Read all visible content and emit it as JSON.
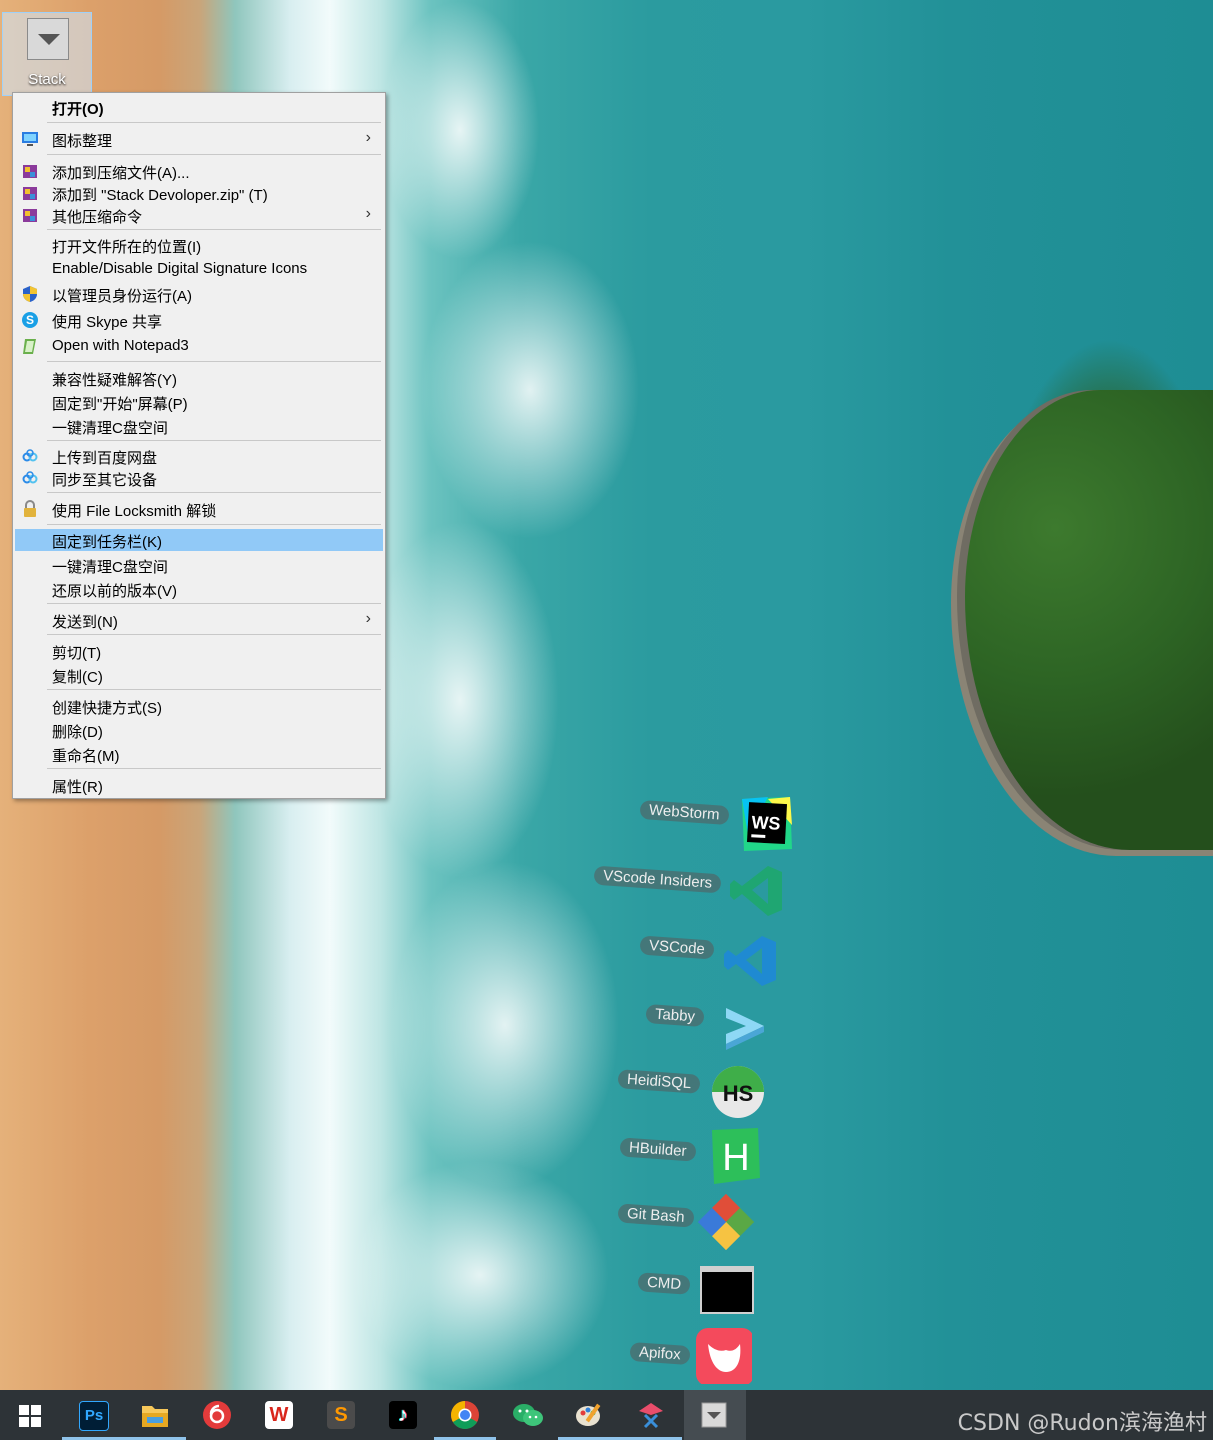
{
  "desktop_icon": {
    "label": "Stack"
  },
  "context_menu": {
    "items": [
      {
        "label": "打开(O)",
        "icon": null
      },
      {
        "label": "图标整理",
        "icon": "monitor-icon",
        "submenu": true
      },
      {
        "label": "添加到压缩文件(A)...",
        "icon": "winrar-icon"
      },
      {
        "label": "添加到 \"Stack Devoloper.zip\" (T)",
        "icon": "winrar-icon"
      },
      {
        "label": "其他压缩命令",
        "icon": "winrar-icon",
        "submenu": true
      },
      {
        "label": "打开文件所在的位置(I)",
        "icon": null
      },
      {
        "label": "Enable/Disable Digital Signature Icons",
        "icon": null
      },
      {
        "label": "以管理员身份运行(A)",
        "icon": "uac-shield-icon"
      },
      {
        "label": "使用 Skype 共享",
        "icon": "skype-icon"
      },
      {
        "label": "Open with Notepad3",
        "icon": "notepad3-icon"
      },
      {
        "label": "兼容性疑难解答(Y)",
        "icon": null
      },
      {
        "label": "固定到\"开始\"屏幕(P)",
        "icon": null
      },
      {
        "label": "一键清理C盘空间",
        "icon": null
      },
      {
        "label": "上传到百度网盘",
        "icon": "baidu-netdisk-icon"
      },
      {
        "label": "同步至其它设备",
        "icon": "baidu-netdisk-icon"
      },
      {
        "label": "使用 File Locksmith 解锁",
        "icon": "lock-icon"
      },
      {
        "label": "固定到任务栏(K)",
        "icon": null,
        "highlighted": true
      },
      {
        "label": "一键清理C盘空间",
        "icon": null
      },
      {
        "label": "还原以前的版本(V)",
        "icon": null
      },
      {
        "label": "发送到(N)",
        "icon": null,
        "submenu": true
      },
      {
        "label": "剪切(T)",
        "icon": null
      },
      {
        "label": "复制(C)",
        "icon": null
      },
      {
        "label": "创建快捷方式(S)",
        "icon": null
      },
      {
        "label": "删除(D)",
        "icon": null
      },
      {
        "label": "重命名(M)",
        "icon": null
      },
      {
        "label": "属性(R)",
        "icon": null
      }
    ],
    "submenu_arrow": "›"
  },
  "dock": {
    "items": [
      {
        "label": "WebStorm",
        "icon": "webstorm-icon",
        "badge": "WS"
      },
      {
        "label": "VScode Insiders",
        "icon": "vscode-insiders-icon"
      },
      {
        "label": "VSCode",
        "icon": "vscode-icon"
      },
      {
        "label": "Tabby",
        "icon": "tabby-icon"
      },
      {
        "label": "HeidiSQL",
        "icon": "heidisql-icon",
        "badge": "HS"
      },
      {
        "label": "HBuilder",
        "icon": "hbuilder-icon",
        "badge": "H"
      },
      {
        "label": "Git Bash",
        "icon": "git-bash-icon"
      },
      {
        "label": "CMD",
        "icon": "cmd-icon"
      },
      {
        "label": "Apifox",
        "icon": "apifox-icon"
      }
    ]
  },
  "taskbar": {
    "items": [
      {
        "name": "start",
        "icon": "windows-start-icon"
      },
      {
        "name": "photoshop",
        "icon": "photoshop-icon",
        "glyph": "Ps",
        "color": "#001e36",
        "active": true
      },
      {
        "name": "file-explorer",
        "icon": "folder-icon",
        "active": true
      },
      {
        "name": "netease-music",
        "icon": "netease-music-icon",
        "color": "#e33b3b"
      },
      {
        "name": "wps",
        "icon": "wps-icon",
        "glyph": "W",
        "color": "#d9261c"
      },
      {
        "name": "sublime",
        "icon": "sublime-text-icon",
        "glyph": "S",
        "color": "#4b4b4b"
      },
      {
        "name": "tiktok",
        "icon": "tiktok-icon",
        "glyph": "♪",
        "color": "#000000"
      },
      {
        "name": "chrome",
        "icon": "chrome-icon",
        "active": true
      },
      {
        "name": "wechat",
        "icon": "wechat-icon",
        "color": "#2aae67"
      },
      {
        "name": "paint",
        "icon": "paint-icon",
        "active": true
      },
      {
        "name": "snipaste",
        "icon": "snipaste-icon",
        "active": true
      },
      {
        "name": "stack",
        "icon": "stack-icon",
        "current": true
      }
    ]
  },
  "watermark": "CSDN @Rudon滨海渔村",
  "colors": {
    "menu_highlight": "#91c9f7",
    "taskbar": "#2d3337",
    "menu_bg": "#f0f0f0"
  }
}
